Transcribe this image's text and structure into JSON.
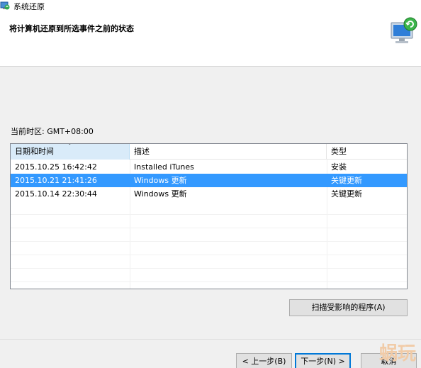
{
  "window": {
    "title": "系统还原"
  },
  "header": {
    "title": "将计算机还原到所选事件之前的状态"
  },
  "timezone": "当前时区: GMT+08:00",
  "table": {
    "columns": [
      "日期和时间",
      "描述",
      "类型"
    ],
    "rows": [
      [
        "2015.10.25 16:42:42",
        "Installed iTunes",
        "安装"
      ],
      [
        "2015.10.21 21:41:26",
        "Windows 更新",
        "关键更新"
      ],
      [
        "2015.10.14 22:30:44",
        "Windows 更新",
        "关键更新"
      ]
    ],
    "selected_row": 1
  },
  "buttons": {
    "scan": "扫描受影响的程序(A)",
    "back": "< 上一步(B)",
    "next": "下一步(N) >",
    "cancel": "取消"
  },
  "watermark": "蜗玩",
  "colors": {
    "selection": "#3399ff",
    "header_sorted": "#d9ebf9",
    "focus": "#0078d7"
  }
}
